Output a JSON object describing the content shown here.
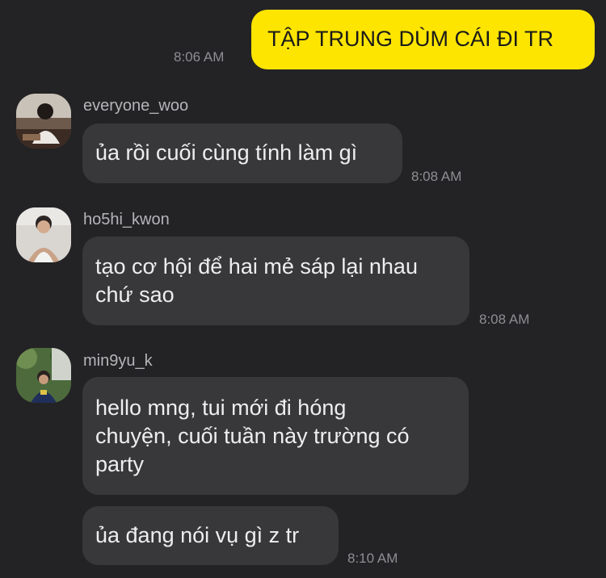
{
  "messages": [
    {
      "id": "m1",
      "outgoing": true,
      "text": "TẬP TRUNG DÙM CÁI ĐI TR",
      "time": "8:06 AM",
      "bubble_color": "#fee500"
    },
    {
      "id": "m2",
      "outgoing": false,
      "sender": "everyone_woo",
      "text": "ủa rồi cuối cùng tính làm gì",
      "time": "8:08 AM"
    },
    {
      "id": "m3",
      "outgoing": false,
      "sender": "ho5hi_kwon",
      "text": "tạo cơ hội để hai mẻ sáp lại nhau\nchứ sao",
      "time": "8:08 AM"
    },
    {
      "id": "m4",
      "outgoing": false,
      "sender": "min9yu_k",
      "text": "hello mng, tui mới đi hóng\nchuyện, cuối tuần này trường có\nparty",
      "time": ""
    },
    {
      "id": "m5",
      "outgoing": false,
      "sender": "min9yu_k",
      "text": "ủa đang nói vụ gì z tr",
      "time": "8:10 AM"
    }
  ],
  "theme": {
    "background": "#232325",
    "incoming_bubble": "#38383b",
    "outgoing_bubble": "#fee500"
  }
}
